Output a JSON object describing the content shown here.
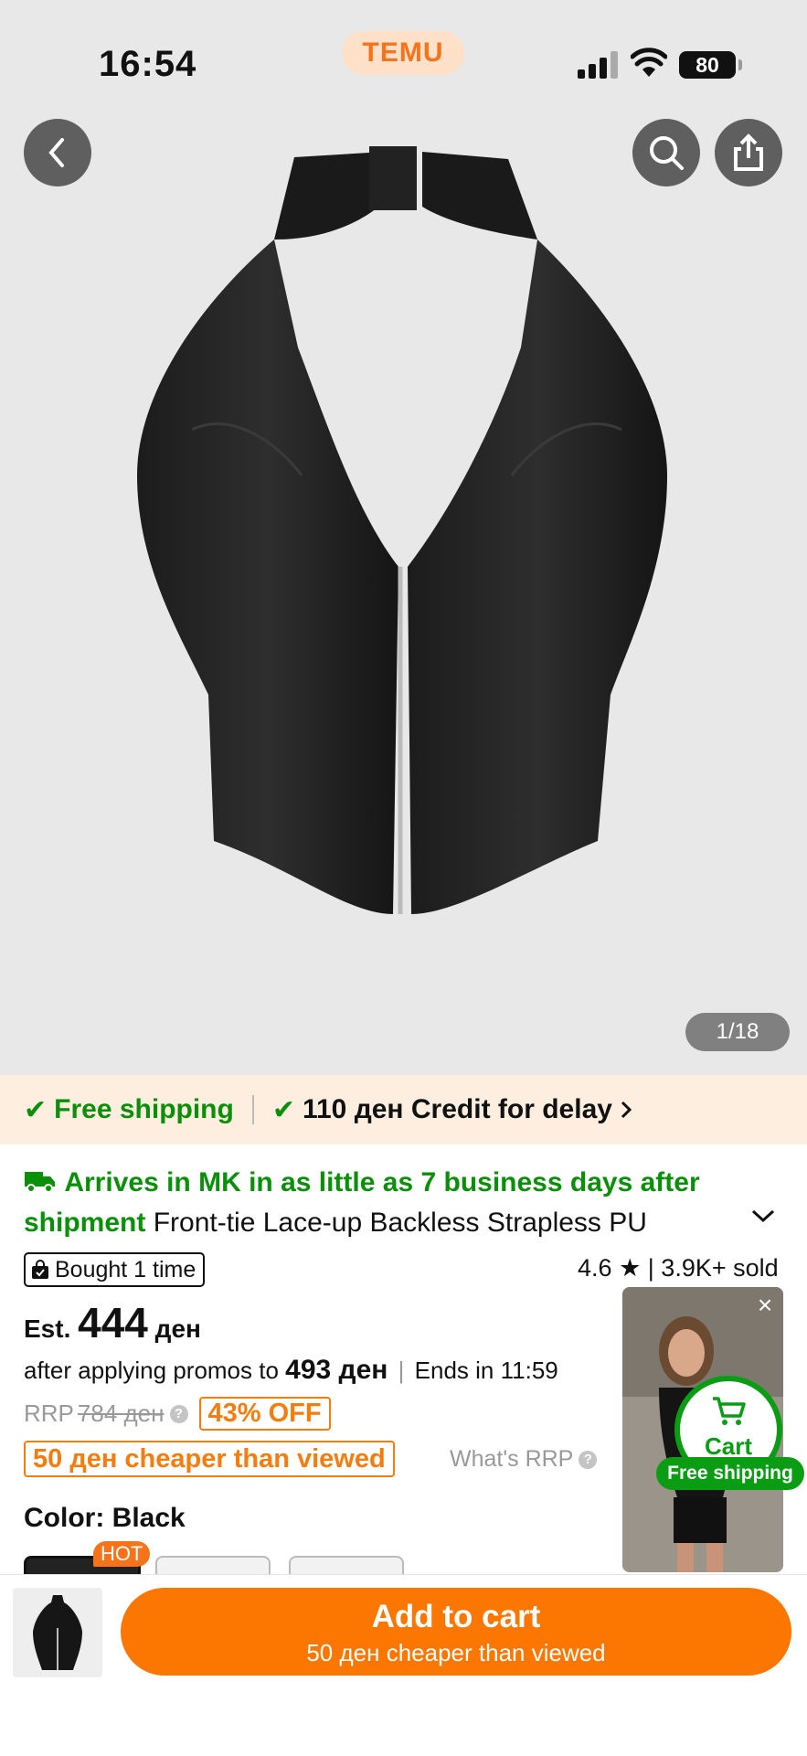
{
  "status_bar": {
    "time": "16:54",
    "brand": "TEMU",
    "battery": "80"
  },
  "gallery": {
    "counter": "1/18"
  },
  "shipping_bar": {
    "free_shipping": "Free shipping",
    "credit": "110 ден Credit for delay"
  },
  "product": {
    "arrival": "Arrives in MK in as little as  7 business days after shipment",
    "title": "Front-tie Lace-up Backless Strapless PU",
    "bought": "Bought 1 time",
    "rating": "4.6",
    "sold": "| 3.9K+ sold",
    "est_label": "Est.",
    "est_price": "444",
    "currency": "ден",
    "promo_prefix": "after applying promos to",
    "promo_price": "493 ден",
    "ends": "Ends in 11:59",
    "rrp_label": "RRP",
    "rrp_price": "784 ден",
    "discount": "43% OFF",
    "cheaper": "50 ден cheaper than viewed",
    "whats_rrp": "What's RRP",
    "color_label": "Color: Black",
    "hot_badge": "HOT"
  },
  "floating_cart": {
    "label": "Cart",
    "shipping": "Free shipping",
    "close": "×"
  },
  "bottom_bar": {
    "button_main": "Add to cart",
    "button_sub": "50 ден cheaper than viewed"
  },
  "colors": {
    "accent_orange": "#fb7701",
    "green": "#0a8f08"
  }
}
